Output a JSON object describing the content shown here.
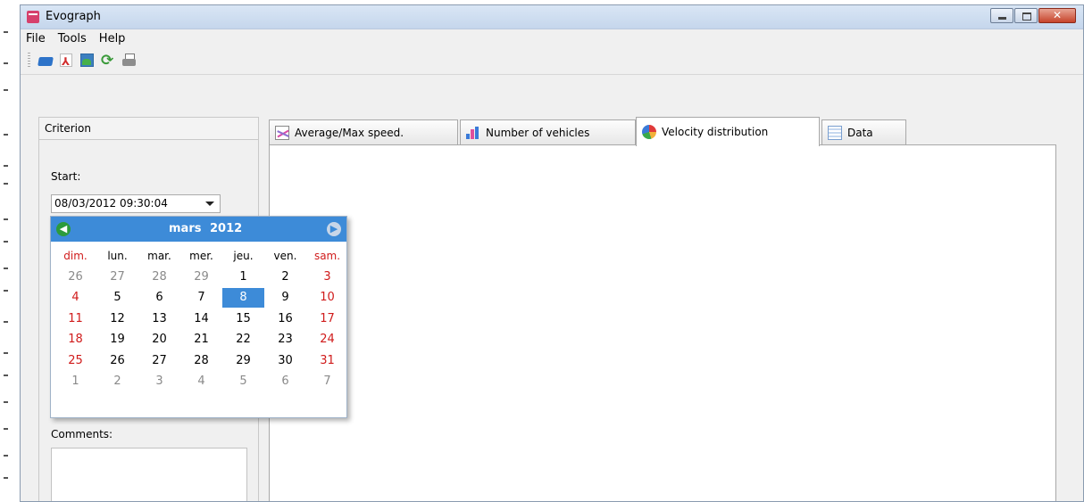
{
  "window": {
    "title": "Evograph"
  },
  "menu": [
    "File",
    "Tools",
    "Help"
  ],
  "toolbar": [
    "open-icon",
    "pdf-icon",
    "image-export-icon",
    "refresh-icon",
    "print-icon"
  ],
  "criterion": {
    "header": "Criterion",
    "start_label": "Start:",
    "start_value": "08/03/2012 09:30:04",
    "comments_label": "Comments:"
  },
  "tabs": [
    {
      "label": "Average/Max speed."
    },
    {
      "label": "Number of vehicles"
    },
    {
      "label": "Velocity distribution"
    },
    {
      "label": "Data"
    }
  ],
  "active_tab": "Velocity distribution",
  "calendar": {
    "month": "mars",
    "year": "2012",
    "weekdays": [
      "dim.",
      "lun.",
      "mar.",
      "mer.",
      "jeu.",
      "ven.",
      "sam."
    ],
    "weeks": [
      [
        "26",
        "27",
        "28",
        "29",
        "1",
        "2",
        "3"
      ],
      [
        "4",
        "5",
        "6",
        "7",
        "8",
        "9",
        "10"
      ],
      [
        "11",
        "12",
        "13",
        "14",
        "15",
        "16",
        "17"
      ],
      [
        "18",
        "19",
        "20",
        "21",
        "22",
        "23",
        "24"
      ],
      [
        "25",
        "26",
        "27",
        "28",
        "29",
        "30",
        "31"
      ],
      [
        "1",
        "2",
        "3",
        "4",
        "5",
        "6",
        "7"
      ]
    ],
    "selected_day": "8"
  },
  "colors": {
    "calendar_header": "#3d8bd8",
    "weekend_text": "#d01b1b",
    "other_month_text": "#8a8a8a"
  }
}
